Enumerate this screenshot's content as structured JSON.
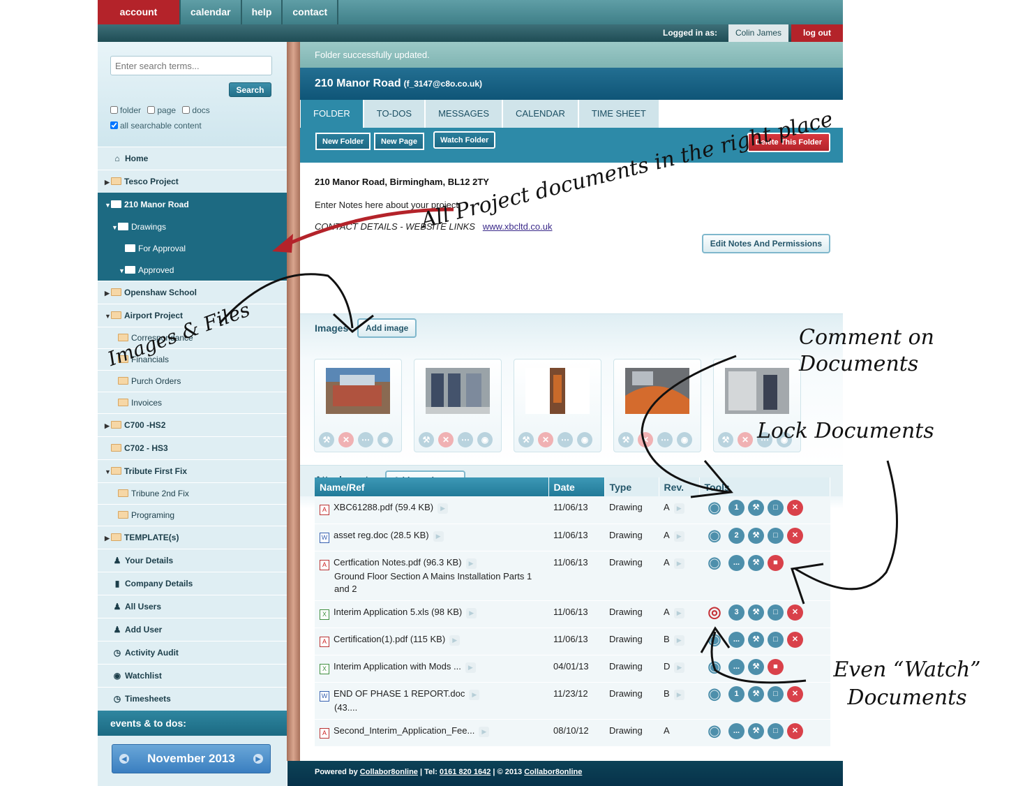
{
  "topnav": {
    "tabs": [
      "account home",
      "calendar",
      "help",
      "contact"
    ]
  },
  "userbar": {
    "logged_in_label": "Logged in as:",
    "user_name": "Colin James",
    "logout_label": "log out"
  },
  "search": {
    "placeholder": "Enter search terms...",
    "button_label": "Search",
    "filters": [
      "folder",
      "page",
      "docs"
    ],
    "all_label": "all searchable content"
  },
  "sidebar": {
    "items": [
      {
        "label": "Home"
      },
      {
        "label": "Tesco Project"
      },
      {
        "label": "210 Manor Road"
      },
      {
        "label": "Drawings"
      },
      {
        "label": "For Approval"
      },
      {
        "label": "Approved"
      },
      {
        "label": "Openshaw School"
      },
      {
        "label": "Airport Project"
      },
      {
        "label": "Correspondance"
      },
      {
        "label": "Financials"
      },
      {
        "label": "Purch Orders"
      },
      {
        "label": "Invoices"
      },
      {
        "label": "C700 -HS2"
      },
      {
        "label": "C702 - HS3"
      },
      {
        "label": "Tribute First Fix"
      },
      {
        "label": "Tribune 2nd Fix"
      },
      {
        "label": "Programing"
      },
      {
        "label": "TEMPLATE(s)"
      },
      {
        "label": "Your Details"
      },
      {
        "label": "Company Details"
      },
      {
        "label": "All Users"
      },
      {
        "label": "Add User"
      },
      {
        "label": "Activity Audit"
      },
      {
        "label": "Watchlist"
      },
      {
        "label": "Timesheets"
      }
    ],
    "events_label": "events & to dos:",
    "calendar_month": "November 2013"
  },
  "main": {
    "flash": "Folder successfully updated.",
    "folder_name": "210 Manor Road",
    "folder_email": "(f_3147@c8o.co.uk)",
    "tabs": [
      "FOLDER",
      "TO-DOS",
      "MESSAGES",
      "CALENDAR",
      "TIME SHEET"
    ],
    "toolbar": {
      "new_folder": "New Folder",
      "new_page": "New Page",
      "watch_folder": "Watch Folder",
      "delete_folder": "Delete This Folder"
    },
    "notes": {
      "address": "210 Manor Road, Birmingham, BL12 2TY",
      "intro": "Enter Notes here about your project",
      "contact": "CONTACT DETAILS - WEBSITE LINKS",
      "link": "www.xbcltd.co.uk",
      "edit_button": "Edit Notes And Permissions"
    },
    "images": {
      "title": "Images",
      "add_button": "Add image"
    },
    "attachments": {
      "title": "Attachments",
      "add_button": "Add attachment"
    },
    "table": {
      "headers": [
        "Name/Ref",
        "Date",
        "Type",
        "Rev.",
        "Tools"
      ],
      "rows": [
        {
          "icon": "pdf",
          "name": "XBC61288.pdf (59.4 KB)",
          "desc": "",
          "date": "11/06/13",
          "type": "Drawing",
          "rev": "A",
          "comments": "1",
          "lock": "open",
          "watch": "on"
        },
        {
          "icon": "doc",
          "name": "asset reg.doc (28.5 KB)",
          "desc": "",
          "date": "11/06/13",
          "type": "Drawing",
          "rev": "A",
          "comments": "2",
          "lock": "open",
          "watch": "on"
        },
        {
          "icon": "pdf",
          "name": "Certfication Notes.pdf (96.3 KB)",
          "desc": "Ground Floor Section A Mains Installation Parts 1 and 2",
          "date": "11/06/13",
          "type": "Drawing",
          "rev": "A",
          "comments": "...",
          "lock": "closed",
          "watch": "on"
        },
        {
          "icon": "xls",
          "name": "Interim Application 5.xls (98 KB)",
          "desc": "",
          "date": "11/06/13",
          "type": "Drawing",
          "rev": "A",
          "comments": "3",
          "lock": "open",
          "watch": "off"
        },
        {
          "icon": "pdf",
          "name": "Certification(1).pdf (115 KB)",
          "desc": "",
          "date": "11/06/13",
          "type": "Drawing",
          "rev": "B",
          "comments": "...",
          "lock": "open",
          "watch": "on"
        },
        {
          "icon": "xls",
          "name": "Interim Application with Mods ...",
          "desc": "",
          "date": "04/01/13",
          "type": "Drawing",
          "rev": "D",
          "comments": "...",
          "lock": "closed",
          "watch": "on"
        },
        {
          "icon": "doc",
          "name": "END OF PHASE 1 REPORT.doc",
          "desc": "(43....",
          "date": "11/23/12",
          "type": "Drawing",
          "rev": "B",
          "comments": "1",
          "lock": "open",
          "watch": "on"
        },
        {
          "icon": "pdf",
          "name": "Second_Interim_Application_Fee...",
          "desc": "",
          "date": "08/10/12",
          "type": "Drawing",
          "rev": "A",
          "comments": "...",
          "lock": "open",
          "watch": "on"
        }
      ]
    }
  },
  "footer": {
    "prefix": "Powered by ",
    "brand": "Collabor8online",
    "tel": " | Tel: ",
    "phone": "0161 820 1642",
    "copy": " | © 2013 ",
    "brand2": "Collabor8online"
  },
  "annotations": {
    "project": "All Project documents in the right place",
    "images": "Images & Files",
    "comment": "Comment on Documents",
    "lock": "Lock Documents",
    "watch": "Even “Watch” Documents"
  },
  "colors": {
    "accent": "#2d8aa8",
    "brand_red": "#b4232a",
    "nav_teal": "#1d6a82"
  }
}
